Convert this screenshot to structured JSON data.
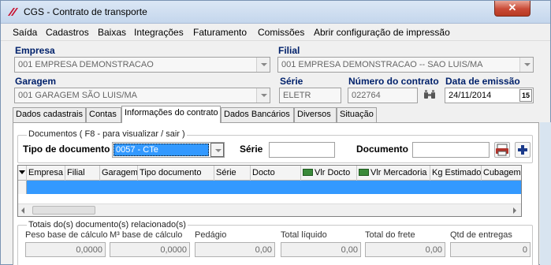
{
  "window": {
    "title": "CGS - Contrato de transporte",
    "close_label": "✕"
  },
  "menu": [
    {
      "label": "Saída"
    },
    {
      "label": "Cadastros"
    },
    {
      "label": "Baixas"
    },
    {
      "label": "Integrações"
    },
    {
      "label": "Faturamento"
    },
    {
      "label": "Comissões"
    },
    {
      "label": "Abrir configuração de impressão"
    }
  ],
  "form": {
    "empresa_label": "Empresa",
    "empresa_value": "001 EMPRESA DEMONSTRACAO",
    "filial_label": "Filial",
    "filial_value": "001 EMPRESA DEMONSTRACAO -- SAO LUIS/MA",
    "garagem_label": "Garagem",
    "garagem_value": "001 GARAGEM SÃO LUIS/MA",
    "serie_label": "Série",
    "serie_value": "ELETR",
    "numero_label": "Número do contrato",
    "numero_value": "022764",
    "data_label": "Data de emissão",
    "data_value": "24/11/2014",
    "calendar_label": "15"
  },
  "tabs": [
    {
      "label": "Dados cadastrais"
    },
    {
      "label": "Contas"
    },
    {
      "label": "Informações do contrato"
    },
    {
      "label": "Dados Bancários"
    },
    {
      "label": "Diversos"
    },
    {
      "label": "Situação"
    }
  ],
  "documentos": {
    "group_title": "Documentos ( F8 - para visualizar / sair )",
    "tipo_label": "Tipo de documento",
    "tipo_value": "0057 - CTe",
    "serie_label": "Série",
    "serie_value": "",
    "documento_label": "Documento",
    "documento_value": ""
  },
  "grid": {
    "columns": [
      "Empresa",
      "Filial",
      "Garagem",
      "Tipo documento",
      "Série",
      "Docto",
      "Vlr Docto",
      "Vlr Mercadoria",
      "Kg Estimado",
      "Cubagem"
    ],
    "rows": [
      []
    ]
  },
  "totais": {
    "group_title": "Totais do(s) documento(s) relacionado(s)",
    "fields": [
      {
        "label": "Peso base de cálculo",
        "value": "0,0000"
      },
      {
        "label": "M³ base de cálculo",
        "value": "0,0000"
      },
      {
        "label": "Pedágio",
        "value": "0,00"
      },
      {
        "label": "Total líquido",
        "value": "0,00"
      },
      {
        "label": "Total do frete",
        "value": "0,00"
      },
      {
        "label": "Qtd de entregas",
        "value": "0"
      }
    ]
  },
  "colors": {
    "accent": "#3399ff",
    "label": "#00216b",
    "close": "#c94a36"
  }
}
